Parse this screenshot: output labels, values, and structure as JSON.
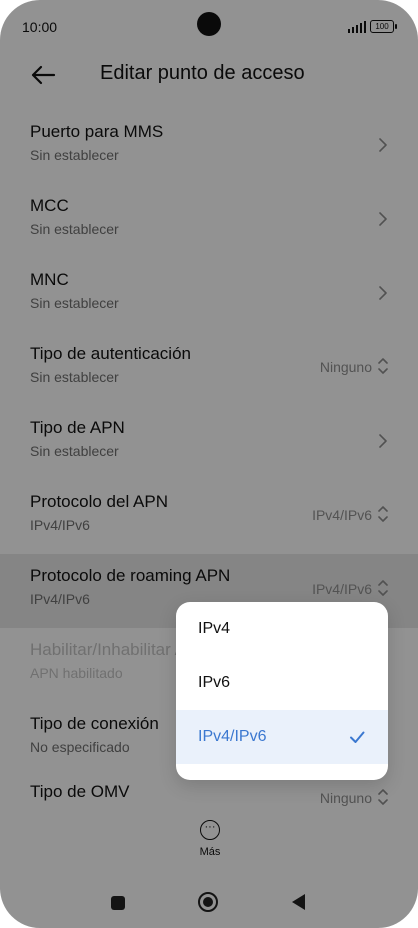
{
  "status": {
    "time": "10:00",
    "battery": "100"
  },
  "header": {
    "title": "Editar punto de acceso"
  },
  "rows": [
    {
      "label": "Puerto para MMS",
      "sub": "Sin establecer"
    },
    {
      "label": "MCC",
      "sub": "Sin establecer"
    },
    {
      "label": "MNC",
      "sub": "Sin establecer"
    },
    {
      "label": "Tipo de autenticación",
      "sub": "Sin establecer",
      "value": "Ninguno"
    },
    {
      "label": "Tipo de APN",
      "sub": "Sin establecer"
    },
    {
      "label": "Protocolo del APN",
      "sub": "IPv4/IPv6",
      "value": "IPv4/IPv6"
    },
    {
      "label": "Protocolo de roaming APN",
      "sub": "IPv4/IPv6",
      "value": "IPv4/IPv6"
    },
    {
      "label": "Habilitar/Inhabilitar APN",
      "sub": "APN habilitado"
    },
    {
      "label": "Tipo de conexión",
      "sub": "No especificado"
    },
    {
      "label": "Tipo de OMV",
      "value": "Ninguno"
    }
  ],
  "more": {
    "label": "Más"
  },
  "popup": {
    "options": [
      "IPv4",
      "IPv6",
      "IPv4/IPv6"
    ],
    "selected": "IPv4/IPv6"
  },
  "colors": {
    "accent": "#3b78d0",
    "selected_bg": "#eaf1fb"
  },
  "icons": {
    "back": "back-arrow-icon",
    "chevron": "chevron-right-icon",
    "updown": "up-down-chevron-icon",
    "more": "more-horizontal-icon",
    "check": "checkmark-icon"
  }
}
